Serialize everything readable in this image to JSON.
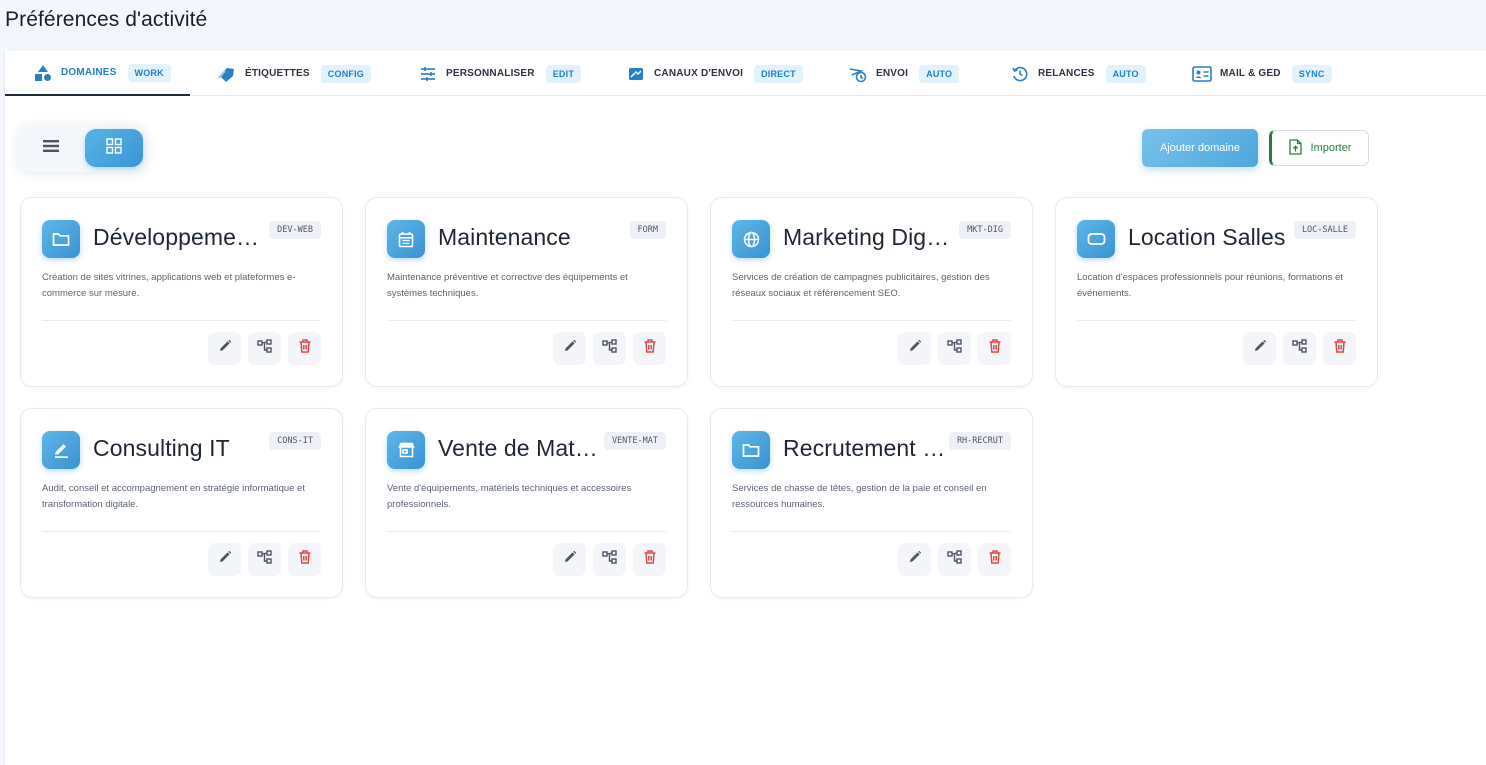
{
  "page": {
    "title": "Préférences d'activité"
  },
  "tabs": [
    {
      "label": "Domaines",
      "badge": "WORK",
      "icon": "shapes-icon",
      "active": true
    },
    {
      "label": "Étiquettes",
      "badge": "CONFIG",
      "icon": "tag-icon",
      "active": false
    },
    {
      "label": "Personnaliser",
      "badge": "EDIT",
      "icon": "sliders-icon",
      "active": false
    },
    {
      "label": "Canaux d'envoi",
      "badge": "DIRECT",
      "icon": "channel-icon",
      "active": false
    },
    {
      "label": "Envoi",
      "badge": "AUTO",
      "icon": "send-clock-icon",
      "active": false
    },
    {
      "label": "Relances",
      "badge": "AUTO",
      "icon": "history-icon",
      "active": false
    },
    {
      "label": "Mail & GED",
      "badge": "SYNC",
      "icon": "contact-card-icon",
      "active": false
    }
  ],
  "toolbar": {
    "view_modes": [
      "list",
      "grid"
    ],
    "active_view": "grid",
    "add_label": "Ajouter domaine",
    "import_label": "Importer"
  },
  "colors": {
    "accent": "#3a94d6",
    "badge_bg": "#e3f1fb",
    "badge_text": "#1e83c9",
    "import_green": "#2e7d3e",
    "delete_red": "#e04848"
  },
  "domains": [
    {
      "title": "Développement Web",
      "code": "DEV-WEB",
      "icon": "folder-icon",
      "description": "Création de sites vitrines, applications web et plateformes e-commerce sur mesure."
    },
    {
      "title": "Maintenance",
      "code": "FORM",
      "icon": "calendar-icon",
      "description": "Maintenance préventive et corrective des équipements et systèmes techniques."
    },
    {
      "title": "Marketing Digital",
      "code": "MKT-DIG",
      "icon": "globe-icon",
      "description": "Services de création de campagnes publicitaires, gestion des réseaux sociaux et référencement SEO."
    },
    {
      "title": "Location Salles",
      "code": "LOC-SALLE",
      "icon": "rounded-rect-icon",
      "description": "Location d'espaces professionnels pour réunions, formations et événements."
    },
    {
      "title": "Consulting IT",
      "code": "CONS-IT",
      "icon": "edit-pen-icon",
      "description": "Audit, conseil et accompagnement en stratégie informatique et transformation digitale."
    },
    {
      "title": "Vente de Matériel",
      "code": "VENTE-MAT",
      "icon": "store-icon",
      "description": "Vente d'équipements, matériels techniques et accessoires professionnels."
    },
    {
      "title": "Recrutement RH",
      "code": "RH-RECRUT",
      "icon": "folder-icon",
      "description": "Services de chasse de têtes, gestion de la paie et conseil en ressources humaines."
    }
  ]
}
